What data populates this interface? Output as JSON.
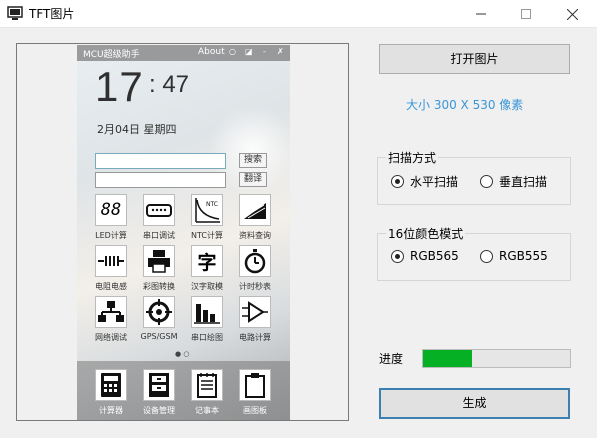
{
  "window": {
    "title": "TFT图片",
    "controls": {
      "minimize": "—",
      "maximize": "☐",
      "close": "✕"
    }
  },
  "preview": {
    "phone": {
      "app_title": "MCU超级助手",
      "about": "About",
      "clock_hour": "17",
      "clock_min": ": 47",
      "date": "2月04日  星期四",
      "search_label": "搜索",
      "translate_label": "翻译",
      "apps": [
        {
          "label": "LED计算",
          "icon": "led-display-icon",
          "glyph": "88"
        },
        {
          "label": "串口调试",
          "icon": "serial-port-icon",
          "glyph": "▭"
        },
        {
          "label": "NTC计算",
          "icon": "ntc-curve-icon",
          "glyph": "NTC"
        },
        {
          "label": "资料查询",
          "icon": "document-lookup-icon",
          "glyph": "▤"
        },
        {
          "label": "电阻电感",
          "icon": "resistor-icon",
          "glyph": "-||||-"
        },
        {
          "label": "彩图转换",
          "icon": "printer-icon",
          "glyph": "▣"
        },
        {
          "label": "汉字取模",
          "icon": "chinese-char-icon",
          "glyph": "字"
        },
        {
          "label": "计时秒表",
          "icon": "stopwatch-icon",
          "glyph": "◷"
        },
        {
          "label": "网络调试",
          "icon": "network-icon",
          "glyph": "品"
        },
        {
          "label": "GPS/GSM",
          "icon": "gps-target-icon",
          "glyph": "⊕"
        },
        {
          "label": "串口绘图",
          "icon": "bar-chart-icon",
          "glyph": "▮▮▮"
        },
        {
          "label": "电路计算",
          "icon": "circuit-icon",
          "glyph": "⊳"
        }
      ],
      "page_dots": "● ○",
      "dock": [
        {
          "label": "计算器",
          "icon": "calculator-icon",
          "glyph": "▦"
        },
        {
          "label": "设备管理",
          "icon": "cabinet-icon",
          "glyph": "▥"
        },
        {
          "label": "记事本",
          "icon": "notepad-icon",
          "glyph": "▤"
        },
        {
          "label": "画图板",
          "icon": "clipboard-icon",
          "glyph": "▢"
        }
      ]
    }
  },
  "controls": {
    "open_button": "打开图片",
    "size_text": "大小 300 X 530 像素",
    "scan_group": {
      "title": "扫描方式",
      "options": [
        {
          "label": "水平扫描",
          "selected": true
        },
        {
          "label": "垂直扫描",
          "selected": false
        }
      ]
    },
    "color_group": {
      "title": "16位颜色模式",
      "options": [
        {
          "label": "RGB565",
          "selected": true
        },
        {
          "label": "RGB555",
          "selected": false
        }
      ]
    },
    "progress": {
      "label": "进度",
      "percent": 33,
      "color": "#06b025"
    },
    "generate_button": "生成"
  },
  "colors": {
    "accent": "#3a96d8",
    "progress": "#06b025"
  }
}
